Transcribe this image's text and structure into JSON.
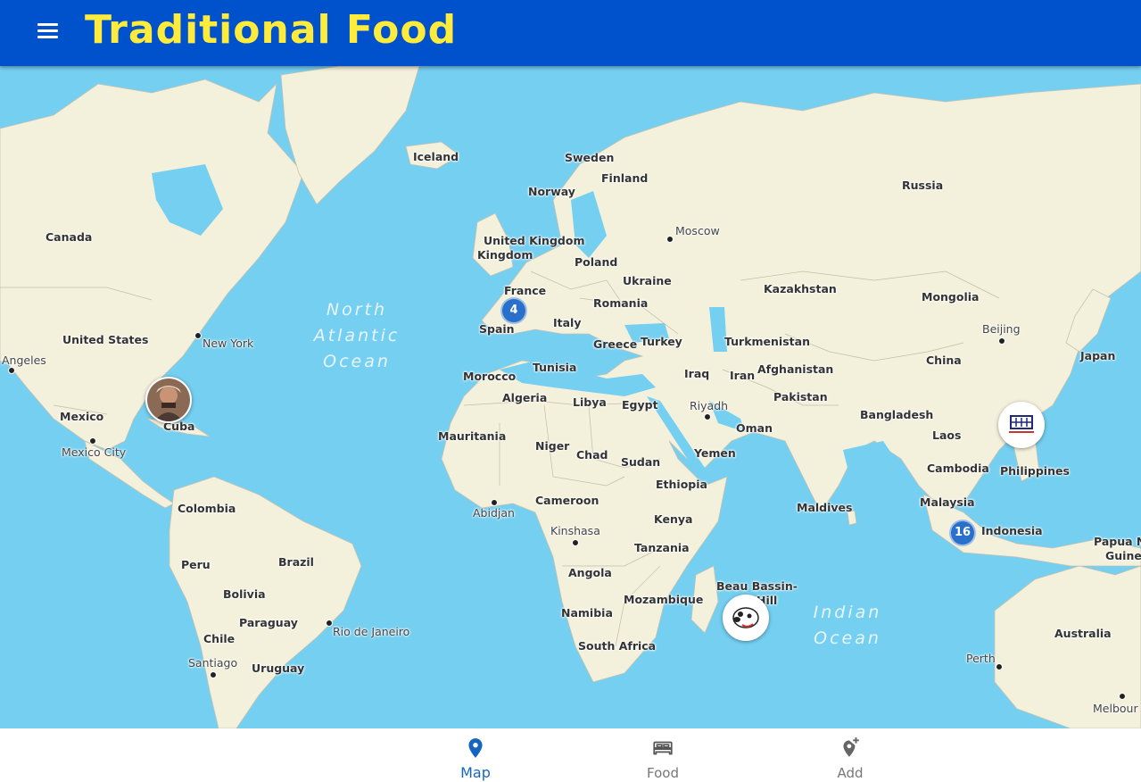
{
  "app": {
    "title": "Traditional Food"
  },
  "map": {
    "countries": [
      "Canada",
      "United States",
      "Mexico",
      "Cuba",
      "Colombia",
      "Peru",
      "Brazil",
      "Bolivia",
      "Paraguay",
      "Chile",
      "Uruguay",
      "Iceland",
      "Sweden",
      "Norway",
      "Finland",
      "United Kingdom",
      "France",
      "Poland",
      "Ukraine",
      "Romania",
      "Italy",
      "Spain",
      "Greece",
      "Turkey",
      "Morocco",
      "Tunisia",
      "Algeria",
      "Libya",
      "Egypt",
      "Mauritania",
      "Niger",
      "Chad",
      "Sudan",
      "Ethiopia",
      "Cameroon",
      "Kenya",
      "Tanzania",
      "Angola",
      "Namibia",
      "Mozambique",
      "South Africa",
      "Russia",
      "Kazakhstan",
      "Mongolia",
      "Turkmenistan",
      "Afghanistan",
      "Iraq",
      "Iran",
      "Pakistan",
      "Oman",
      "Yemen",
      "China",
      "Japan",
      "Bangladesh",
      "Laos",
      "Cambodia",
      "Philippines",
      "Malaysia",
      "Indonesia",
      "Maldives",
      "Australia"
    ],
    "cities": [
      "Angeles",
      "New York",
      "Mexico City",
      "Rio de Janeiro",
      "Santiago",
      "Moscow",
      "Riyadh",
      "Abidjan",
      "Kinshasa",
      "Beijing",
      "Perth",
      "Melbour"
    ],
    "extra_labels": {
      "united_kingdom_2": "Kingdom",
      "beau_bassin": "Beau Bassin-",
      "beau_bassin_2": "Hill",
      "papua": "Papua N",
      "papua_2": "Guinea"
    },
    "oceans": {
      "north_atlantic": [
        "North",
        "Atlantic",
        "Ocean"
      ],
      "indian": [
        "Indian",
        "Ocean"
      ]
    },
    "clusters": [
      {
        "label": "4"
      },
      {
        "label": "16"
      }
    ],
    "markers": [
      "avatar-photo",
      "avatar-cartoon",
      "avatar-logo"
    ]
  },
  "nav": {
    "items": [
      {
        "label": "Map",
        "icon": "map-pin-icon",
        "active": true
      },
      {
        "label": "Food",
        "icon": "bed-icon",
        "active": false
      },
      {
        "label": "Add",
        "icon": "add-location-icon",
        "active": false
      }
    ],
    "active_color": "#1565c0",
    "inactive_color": "#777777"
  },
  "colors": {
    "appbar": "#0052cc",
    "title": "#ffeb3b",
    "ocean": "#75cff0",
    "land": "#f3f1dc"
  }
}
